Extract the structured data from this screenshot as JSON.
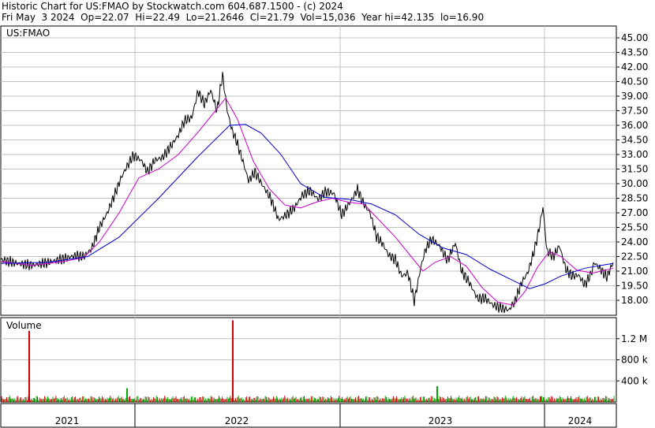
{
  "header": {
    "line1": "Historic Chart for US:FMAO by Stockwatch.com 604.687.1500 - (c) 2024",
    "line2": "Fri May  3 2024  Op=22.07  Hi=22.49  Lo=21.2646  Cl=21.79  Vol=15,036  Year hi=42.135  lo=16.90"
  },
  "chart_data": [
    {
      "type": "line",
      "title": "US:FMAO",
      "price_ticks": [
        "45.00",
        "43.50",
        "42.00",
        "40.50",
        "39.00",
        "37.50",
        "36.00",
        "34.50",
        "33.00",
        "31.50",
        "30.00",
        "28.50",
        "27.00",
        "25.50",
        "24.00",
        "22.50",
        "21.00",
        "19.50",
        "18.00"
      ],
      "tick_values": [
        45.0,
        43.5,
        42.0,
        40.5,
        39.0,
        37.5,
        36.0,
        34.5,
        33.0,
        31.5,
        30.0,
        28.5,
        27.0,
        25.5,
        24.0,
        22.5,
        21.0,
        19.5,
        18.0
      ],
      "ylim": [
        16.5,
        46.0
      ],
      "x_labels": [
        "2021",
        "2022",
        "2023",
        "2024"
      ],
      "grid": true,
      "colors": {
        "price": "#000000",
        "ma_short": "#cc00cc",
        "ma_long": "#0000cc",
        "grid": "#c0c0c0"
      },
      "series": [
        {
          "key": "price",
          "values": [
            [
              0,
              22.2
            ],
            [
              20,
              21.8
            ],
            [
              40,
              21.6
            ],
            [
              60,
              21.9
            ],
            [
              80,
              22.3
            ],
            [
              95,
              22.6
            ],
            [
              105,
              22.5
            ],
            [
              115,
              23.3
            ],
            [
              125,
              25.5
            ],
            [
              135,
              27.0
            ],
            [
              145,
              29.0
            ],
            [
              152,
              30.5
            ],
            [
              160,
              31.8
            ],
            [
              168,
              32.9
            ],
            [
              178,
              32.4
            ],
            [
              186,
              31.2
            ],
            [
              195,
              32.4
            ],
            [
              205,
              32.7
            ],
            [
              215,
              33.8
            ],
            [
              225,
              35.0
            ],
            [
              233,
              36.5
            ],
            [
              242,
              36.8
            ],
            [
              250,
              39.5
            ],
            [
              258,
              38.2
            ],
            [
              266,
              39.6
            ],
            [
              274,
              37.5
            ],
            [
              281,
              41.2
            ],
            [
              287,
              37.5
            ],
            [
              293,
              35.5
            ],
            [
              299,
              34.3
            ],
            [
              306,
              32.5
            ],
            [
              314,
              30.3
            ],
            [
              322,
              31.2
            ],
            [
              332,
              29.8
            ],
            [
              342,
              28.5
            ],
            [
              352,
              26.3
            ],
            [
              362,
              26.8
            ],
            [
              372,
              27.5
            ],
            [
              382,
              28.8
            ],
            [
              392,
              29.3
            ],
            [
              402,
              28.4
            ],
            [
              412,
              29.2
            ],
            [
              422,
              29.0
            ],
            [
              432,
              26.8
            ],
            [
              442,
              28.0
            ],
            [
              452,
              29.4
            ],
            [
              460,
              27.9
            ],
            [
              468,
              27.0
            ],
            [
              476,
              24.6
            ],
            [
              484,
              23.8
            ],
            [
              492,
              22.6
            ],
            [
              500,
              22.2
            ],
            [
              508,
              20.5
            ],
            [
              516,
              20.8
            ],
            [
              524,
              17.9
            ],
            [
              532,
              21.3
            ],
            [
              538,
              23.2
            ],
            [
              546,
              24.3
            ],
            [
              556,
              23.6
            ],
            [
              566,
              22.1
            ],
            [
              576,
              23.9
            ],
            [
              584,
              21.0
            ],
            [
              594,
              19.8
            ],
            [
              604,
              18.2
            ],
            [
              614,
              18.2
            ],
            [
              624,
              17.5
            ],
            [
              634,
              17.2
            ],
            [
              644,
              17.0
            ],
            [
              652,
              18.0
            ],
            [
              660,
              19.8
            ],
            [
              668,
              20.9
            ],
            [
              676,
              23.1
            ],
            [
              682,
              25.3
            ],
            [
              687,
              27.6
            ],
            [
              692,
              23.1
            ],
            [
              700,
              22.5
            ],
            [
              708,
              23.6
            ],
            [
              716,
              21.2
            ],
            [
              724,
              20.5
            ],
            [
              732,
              20.6
            ],
            [
              740,
              19.6
            ],
            [
              748,
              20.7
            ],
            [
              752,
              21.9
            ],
            [
              760,
              21.2
            ],
            [
              768,
              20.4
            ],
            [
              776,
              21.9
            ]
          ]
        },
        {
          "key": "ma_short",
          "values": [
            [
              0,
              22.0
            ],
            [
              40,
              21.6
            ],
            [
              80,
              22.0
            ],
            [
              105,
              22.4
            ],
            [
              125,
              24.0
            ],
            [
              150,
              27.0
            ],
            [
              175,
              30.6
            ],
            [
              200,
              31.5
            ],
            [
              225,
              33.0
            ],
            [
              250,
              35.3
            ],
            [
              270,
              37.3
            ],
            [
              285,
              38.8
            ],
            [
              300,
              36.6
            ],
            [
              320,
              32.3
            ],
            [
              340,
              29.5
            ],
            [
              360,
              27.8
            ],
            [
              380,
              27.5
            ],
            [
              400,
              28.1
            ],
            [
              420,
              28.5
            ],
            [
              440,
              28.1
            ],
            [
              460,
              27.9
            ],
            [
              480,
              26.2
            ],
            [
              500,
              24.5
            ],
            [
              520,
              22.5
            ],
            [
              535,
              21.0
            ],
            [
              550,
              21.9
            ],
            [
              570,
              22.5
            ],
            [
              590,
              21.5
            ],
            [
              610,
              19.3
            ],
            [
              630,
              17.8
            ],
            [
              650,
              17.5
            ],
            [
              665,
              19.0
            ],
            [
              680,
              21.4
            ],
            [
              695,
              23.0
            ],
            [
              710,
              22.5
            ],
            [
              730,
              21.1
            ],
            [
              750,
              20.8
            ],
            [
              776,
              21.3
            ]
          ]
        },
        {
          "key": "ma_long",
          "values": [
            [
              0,
              21.8
            ],
            [
              60,
              21.9
            ],
            [
              110,
              22.5
            ],
            [
              150,
              24.5
            ],
            [
              200,
              28.5
            ],
            [
              250,
              32.8
            ],
            [
              290,
              36.0
            ],
            [
              310,
              36.1
            ],
            [
              330,
              35.2
            ],
            [
              355,
              33.0
            ],
            [
              380,
              30.0
            ],
            [
              410,
              28.6
            ],
            [
              440,
              28.4
            ],
            [
              470,
              27.9
            ],
            [
              500,
              26.8
            ],
            [
              530,
              24.8
            ],
            [
              560,
              23.4
            ],
            [
              590,
              22.7
            ],
            [
              620,
              21.2
            ],
            [
              650,
              20.0
            ],
            [
              670,
              19.2
            ],
            [
              690,
              19.7
            ],
            [
              710,
              20.5
            ],
            [
              740,
              21.3
            ],
            [
              776,
              21.8
            ]
          ]
        }
      ]
    },
    {
      "type": "bar",
      "title": "Volume",
      "vol_ticks": [
        "1.2 M",
        "800 k",
        "400 k"
      ],
      "vol_values": [
        1200000,
        800000,
        400000
      ],
      "ylim": [
        0,
        1600000
      ],
      "colors": {
        "up": "#00aa00",
        "down": "#cc0000"
      },
      "spikes": [
        {
          "x": 36,
          "value": 1350000,
          "dir": "down"
        },
        {
          "x": 160,
          "value": 260000,
          "dir": "up"
        },
        {
          "x": 294,
          "value": 1550000,
          "dir": "down"
        },
        {
          "x": 553,
          "value": 300000,
          "dir": "up"
        },
        {
          "x": 685,
          "value": 110000,
          "dir": "up"
        }
      ]
    }
  ]
}
